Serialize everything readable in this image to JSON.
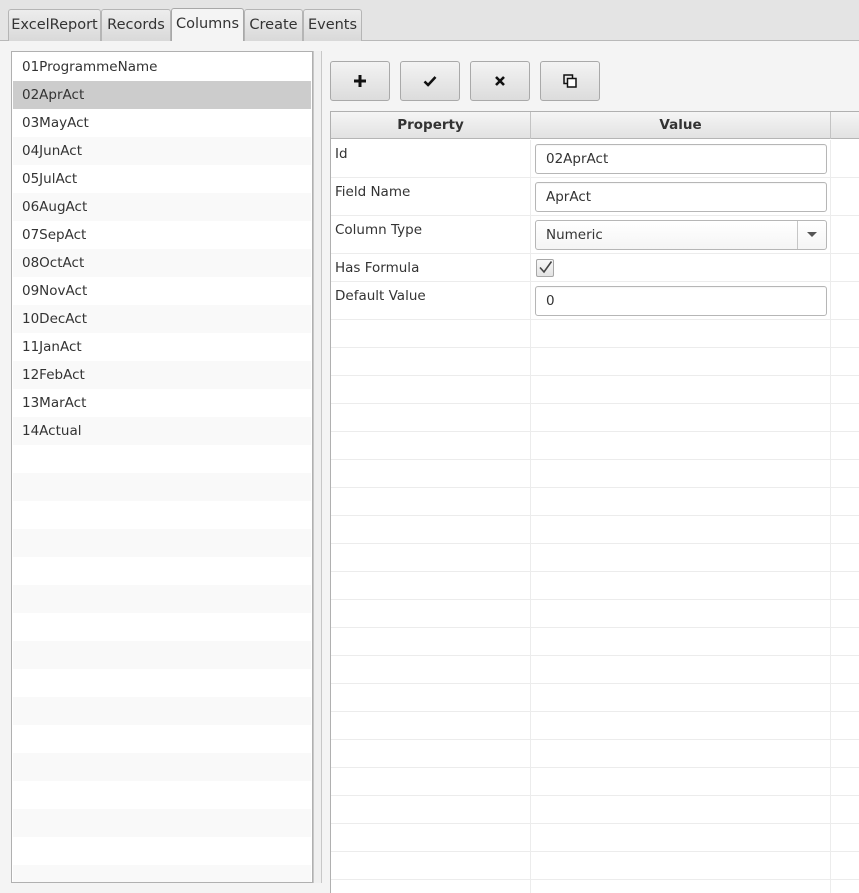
{
  "tabs": [
    {
      "label": "ExcelReport",
      "active": false
    },
    {
      "label": "Records",
      "active": false
    },
    {
      "label": "Columns",
      "active": true
    },
    {
      "label": "Create",
      "active": false
    },
    {
      "label": "Events",
      "active": false
    }
  ],
  "columns_list": {
    "items": [
      "01ProgrammeName",
      "02AprAct",
      "03MayAct",
      "04JunAct",
      "05JulAct",
      "06AugAct",
      "07SepAct",
      "08OctAct",
      "09NovAct",
      "10DecAct",
      "11JanAct",
      "12FebAct",
      "13MarAct",
      "14Actual"
    ],
    "selected_index": 1
  },
  "toolbar": {
    "buttons": [
      {
        "name": "add-button",
        "icon": "plus-icon"
      },
      {
        "name": "apply-button",
        "icon": "check-icon"
      },
      {
        "name": "delete-button",
        "icon": "x-icon"
      },
      {
        "name": "copy-button",
        "icon": "copy-icon"
      }
    ]
  },
  "property_table": {
    "headers": {
      "property": "Property",
      "value": "Value"
    },
    "rows": {
      "id": {
        "label": "Id",
        "value": "02AprAct"
      },
      "field_name": {
        "label": "Field Name",
        "value": "AprAct"
      },
      "column_type": {
        "label": "Column Type",
        "value": "Numeric"
      },
      "has_formula": {
        "label": "Has Formula",
        "checked": true
      },
      "default_value": {
        "label": "Default Value",
        "value": "0"
      }
    }
  },
  "colors": {
    "selected_row": "#cccccc",
    "alt_row": "#f9f9f9",
    "background": "#f4f4f4"
  }
}
